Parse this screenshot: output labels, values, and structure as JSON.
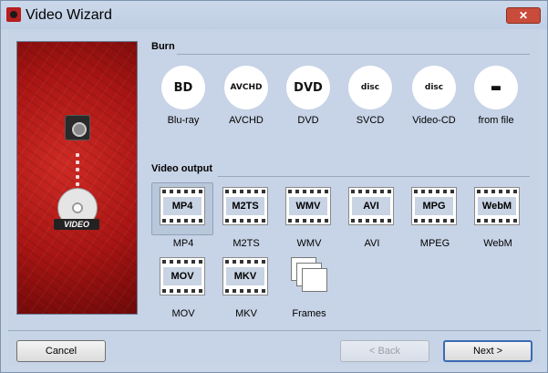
{
  "window": {
    "title": "Video Wizard",
    "close_label": "✕"
  },
  "burn": {
    "title": "Burn",
    "items": [
      {
        "label": "Blu-ray",
        "icon": "bluray-icon",
        "glyph": "BD"
      },
      {
        "label": "AVCHD",
        "icon": "avchd-icon",
        "glyph": "AVCHD"
      },
      {
        "label": "DVD",
        "icon": "dvd-icon",
        "glyph": "DVD"
      },
      {
        "label": "SVCD",
        "icon": "svcd-icon",
        "glyph": "disc"
      },
      {
        "label": "Video-CD",
        "icon": "videocd-icon",
        "glyph": "disc"
      },
      {
        "label": "from file",
        "icon": "folder-icon",
        "glyph": "▬"
      }
    ]
  },
  "video_output": {
    "title": "Video output",
    "items": [
      {
        "label": "MP4",
        "badge": "MP4",
        "selected": true
      },
      {
        "label": "M2TS",
        "badge": "M2TS"
      },
      {
        "label": "WMV",
        "badge": "WMV"
      },
      {
        "label": "AVI",
        "badge": "AVI"
      },
      {
        "label": "MPEG",
        "badge": "MPG"
      },
      {
        "label": "WebM",
        "badge": "WebM"
      },
      {
        "label": "MOV",
        "badge": "MOV"
      },
      {
        "label": "MKV",
        "badge": "MKV"
      },
      {
        "label": "Frames",
        "badge": ""
      }
    ]
  },
  "side_panel": {
    "video_text": "VIDEO"
  },
  "footer": {
    "cancel_label": "Cancel",
    "back_label": "< Back",
    "next_label": "Next >"
  }
}
